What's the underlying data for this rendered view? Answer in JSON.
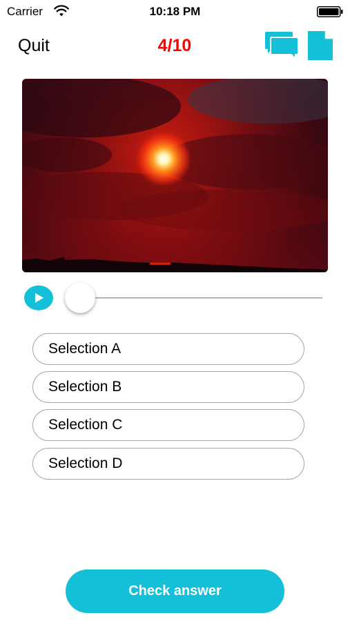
{
  "status_bar": {
    "carrier": "Carrier",
    "time": "10:18 PM",
    "wifi_icon": "wifi-icon",
    "battery_icon": "battery-icon"
  },
  "header": {
    "quit_label": "Quit",
    "progress": "4/10",
    "progress_color": "#ff0000",
    "chat_icon": "chat-bubbles-icon",
    "document_icon": "document-icon"
  },
  "media": {
    "image_subject": "red sunset sky with clouds",
    "play_icon": "play-icon",
    "playback_position": 0
  },
  "options": [
    {
      "label": "Selection A"
    },
    {
      "label": "Selection B"
    },
    {
      "label": "Selection C"
    },
    {
      "label": "Selection D"
    }
  ],
  "footer": {
    "check_label": "Check answer"
  },
  "colors": {
    "accent": "#14bfd8",
    "progress_text": "#ff0000",
    "option_border": "#a8a8a8"
  }
}
